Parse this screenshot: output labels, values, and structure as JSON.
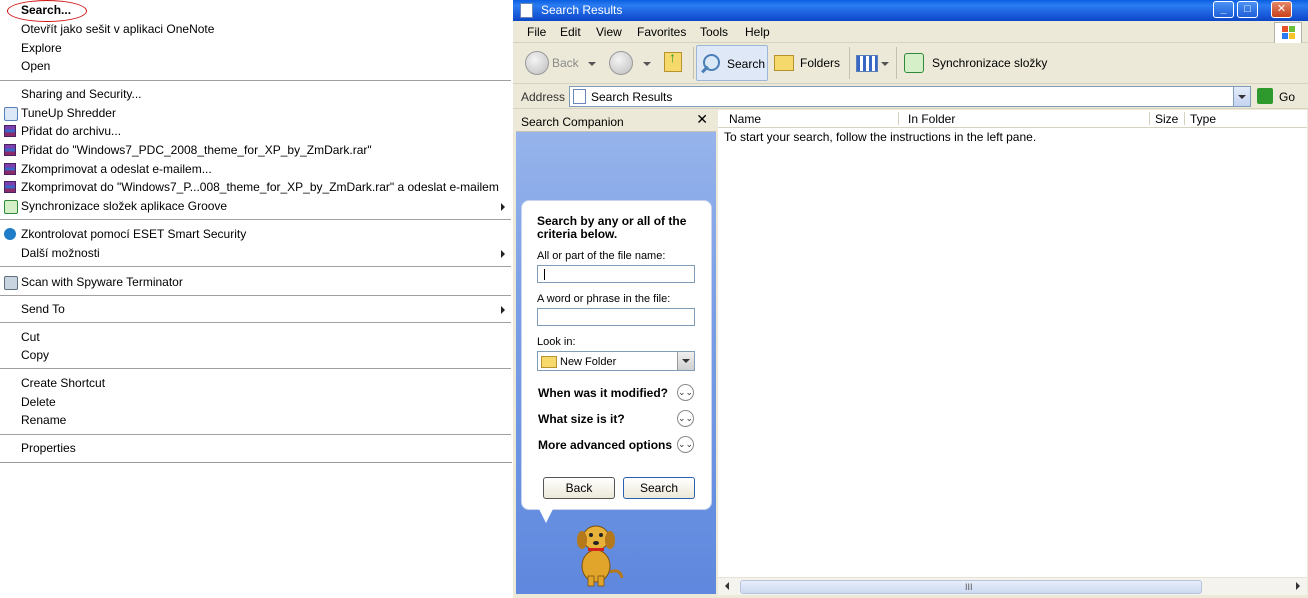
{
  "context_menu": {
    "search_label": "Search...",
    "items": [
      "Otevřít jako sešit v aplikaci OneNote",
      "Explore",
      "Open",
      "Sharing and Security...",
      "TuneUp Shredder",
      "Přidat do archivu...",
      "Přidat do \"Windows7_PDC_2008_theme_for_XP_by_ZmDark.rar\"",
      "Zkomprimovat a odeslat e-mailem...",
      "Zkomprimovat do \"Windows7_P...008_theme_for_XP_by_ZmDark.rar\" a odeslat e-mailem",
      "Synchronizace složek aplikace Groove",
      "Zkontrolovat pomocí ESET Smart Security",
      "Další možnosti",
      "Scan with Spyware Terminator",
      "Send To",
      "Cut",
      "Copy",
      "Create Shortcut",
      "Delete",
      "Rename",
      "Properties"
    ]
  },
  "window": {
    "title": "Search Results",
    "menu": [
      "File",
      "Edit",
      "View",
      "Favorites",
      "Tools",
      "Help"
    ],
    "toolbar": {
      "back": "Back",
      "search": "Search",
      "folders": "Folders",
      "sync": "Synchronizace složky"
    },
    "address": {
      "label": "Address",
      "value": "Search Results",
      "go": "Go"
    }
  },
  "companion": {
    "title": "Search Companion",
    "close": "✕",
    "heading": "Search by any or all of the criteria below.",
    "filename_label": "All or part of the file name:",
    "filename_value": "",
    "phrase_label": "A word or phrase in the file:",
    "phrase_value": "",
    "lookin_label": "Look in:",
    "lookin_value": "New Folder",
    "expanders": [
      "When was it modified?",
      "What size is it?",
      "More advanced options"
    ],
    "back_button": "Back",
    "search_button": "Search"
  },
  "results": {
    "columns": [
      "Name",
      "In Folder",
      "Size",
      "Type"
    ],
    "message": "To start your search, follow the instructions in the left pane."
  },
  "colors": {
    "title_bar": "#1554d4",
    "pane_blue": "#7a9fe6",
    "highlight_ellipse": "#d01010"
  }
}
